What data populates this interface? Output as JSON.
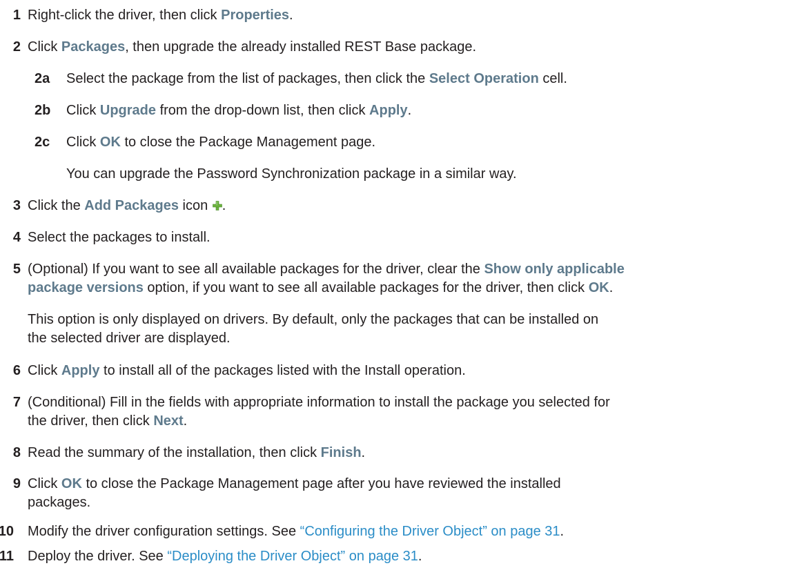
{
  "steps": {
    "s1": {
      "num": "1",
      "pre": "Right-click the driver, then click ",
      "ui": "Properties",
      "post": "."
    },
    "s2": {
      "num": "2",
      "text": "Click ",
      "ui": "Packages",
      "post": ", then upgrade the already installed REST Base package."
    },
    "s2a": {
      "num": "2a",
      "pre": "Select the package from the list of packages, then click the ",
      "ui": "Select Operation",
      "post": " cell."
    },
    "s2b": {
      "num": "2b",
      "pre": "Click ",
      "ui1": "Upgrade",
      "mid": " from the drop-down list, then click ",
      "ui2": "Apply",
      "post": "."
    },
    "s2c": {
      "num": "2c",
      "pre": "Click ",
      "ui": "OK",
      "post": " to close the Package Management page."
    },
    "s2note": "You can upgrade the Password Synchronization package in a similar way.",
    "s3": {
      "num": "3",
      "pre": "Click the ",
      "ui": "Add Packages",
      "post": " icon ",
      "end": "."
    },
    "s4": {
      "num": "4",
      "text": "Select the packages to install."
    },
    "s5": {
      "num": "5",
      "line1_pre": "(Optional) If you want to see all available packages for the driver, clear the ",
      "ui1a": "Show only applicable",
      "ui1b": "package versions",
      "line2_mid": " option, if you want to see all available packages for the driver, then click ",
      "ui2": "OK",
      "post": "."
    },
    "s5note1": "This option is only displayed on drivers. By default, only the packages that can be installed on",
    "s5note2": "the selected driver are displayed.",
    "s6": {
      "num": "6",
      "pre": "Click ",
      "ui": "Apply",
      "post": " to install all of the packages listed with the Install operation."
    },
    "s7": {
      "num": "7",
      "line1": "(Conditional) Fill in the fields with appropriate information to install the package you selected for",
      "line2_pre": "the driver, then click ",
      "ui": "Next",
      "post": "."
    },
    "s8": {
      "num": "8",
      "pre": "Read the summary of the installation, then click ",
      "ui": "Finish",
      "post": "."
    },
    "s9": {
      "num": "9",
      "pre": "Click ",
      "ui": "OK",
      "line1_post": " to close the Package Management page after you have reviewed the installed",
      "line2": "packages."
    },
    "s10": {
      "num": "10",
      "pre": "Modify the driver configuration settings. See ",
      "link": "“Configuring the Driver Object” on page 31",
      "post": "."
    },
    "s11": {
      "num": "11",
      "pre": "Deploy the driver. See ",
      "link": "“Deploying the Driver Object” on page 31",
      "post": "."
    }
  },
  "colors": {
    "ui_text": "#5e7a8c",
    "link": "#2b8dc7",
    "body_text": "#231f20",
    "plus_icon": "#6cb33f"
  },
  "icons": {
    "add_packages": "plus-icon"
  }
}
